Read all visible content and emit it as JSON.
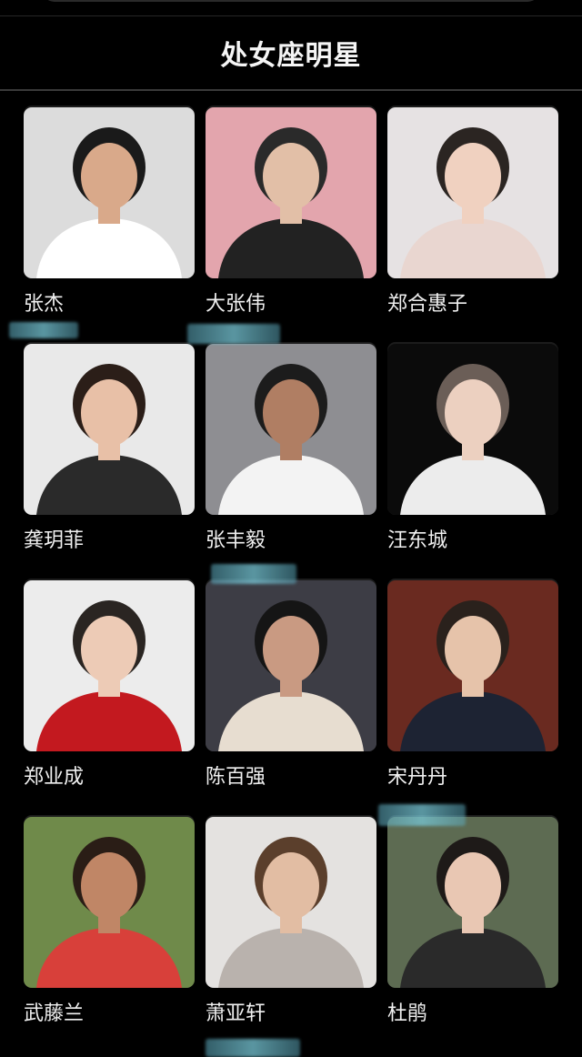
{
  "header": {
    "title": "处女座明星"
  },
  "celebrities": [
    {
      "name": "张杰",
      "bg": "#dcdcdc",
      "shirt": "#ffffff",
      "hair": "#1a1a1a",
      "skin": "#d9a98a"
    },
    {
      "name": "大张伟",
      "bg": "#e3a5ad",
      "shirt": "#222222",
      "hair": "#2a2a2a",
      "skin": "#e2bfa7"
    },
    {
      "name": "郑合惠子",
      "bg": "#e6e2e3",
      "shirt": "#e9d6d0",
      "hair": "#2b2522",
      "skin": "#f0d1c0"
    },
    {
      "name": "龚玥菲",
      "bg": "#e9e9e9",
      "shirt": "#2a2a2a",
      "hair": "#2b1e18",
      "skin": "#e8c0a7"
    },
    {
      "name": "张丰毅",
      "bg": "#8e8e92",
      "shirt": "#f3f3f3",
      "hair": "#1c1c1c",
      "skin": "#b07e63"
    },
    {
      "name": "汪东城",
      "bg": "#0b0b0b",
      "shirt": "#ececec",
      "hair": "#6b5e57",
      "skin": "#ecd0c0"
    },
    {
      "name": "郑业成",
      "bg": "#ececec",
      "shirt": "#c3191f",
      "hair": "#2a2522",
      "skin": "#edcbb6"
    },
    {
      "name": "陈百强",
      "bg": "#3d3d45",
      "shirt": "#e7ddd0",
      "hair": "#151515",
      "skin": "#c99a82"
    },
    {
      "name": "宋丹丹",
      "bg": "#6a2a20",
      "shirt": "#1d2333",
      "hair": "#2a211c",
      "skin": "#e6c3aa"
    },
    {
      "name": "武藤兰",
      "bg": "#6f8a4a",
      "shirt": "#d8403a",
      "hair": "#2a1d16",
      "skin": "#c08666"
    },
    {
      "name": "萧亚轩",
      "bg": "#e4e2e0",
      "shirt": "#b9b2ad",
      "hair": "#5b3f2c",
      "skin": "#e2bda3"
    },
    {
      "name": "杜鹃",
      "bg": "#5d6b52",
      "shirt": "#2a2a2a",
      "hair": "#1e1a18",
      "skin": "#e9c7b3"
    }
  ]
}
